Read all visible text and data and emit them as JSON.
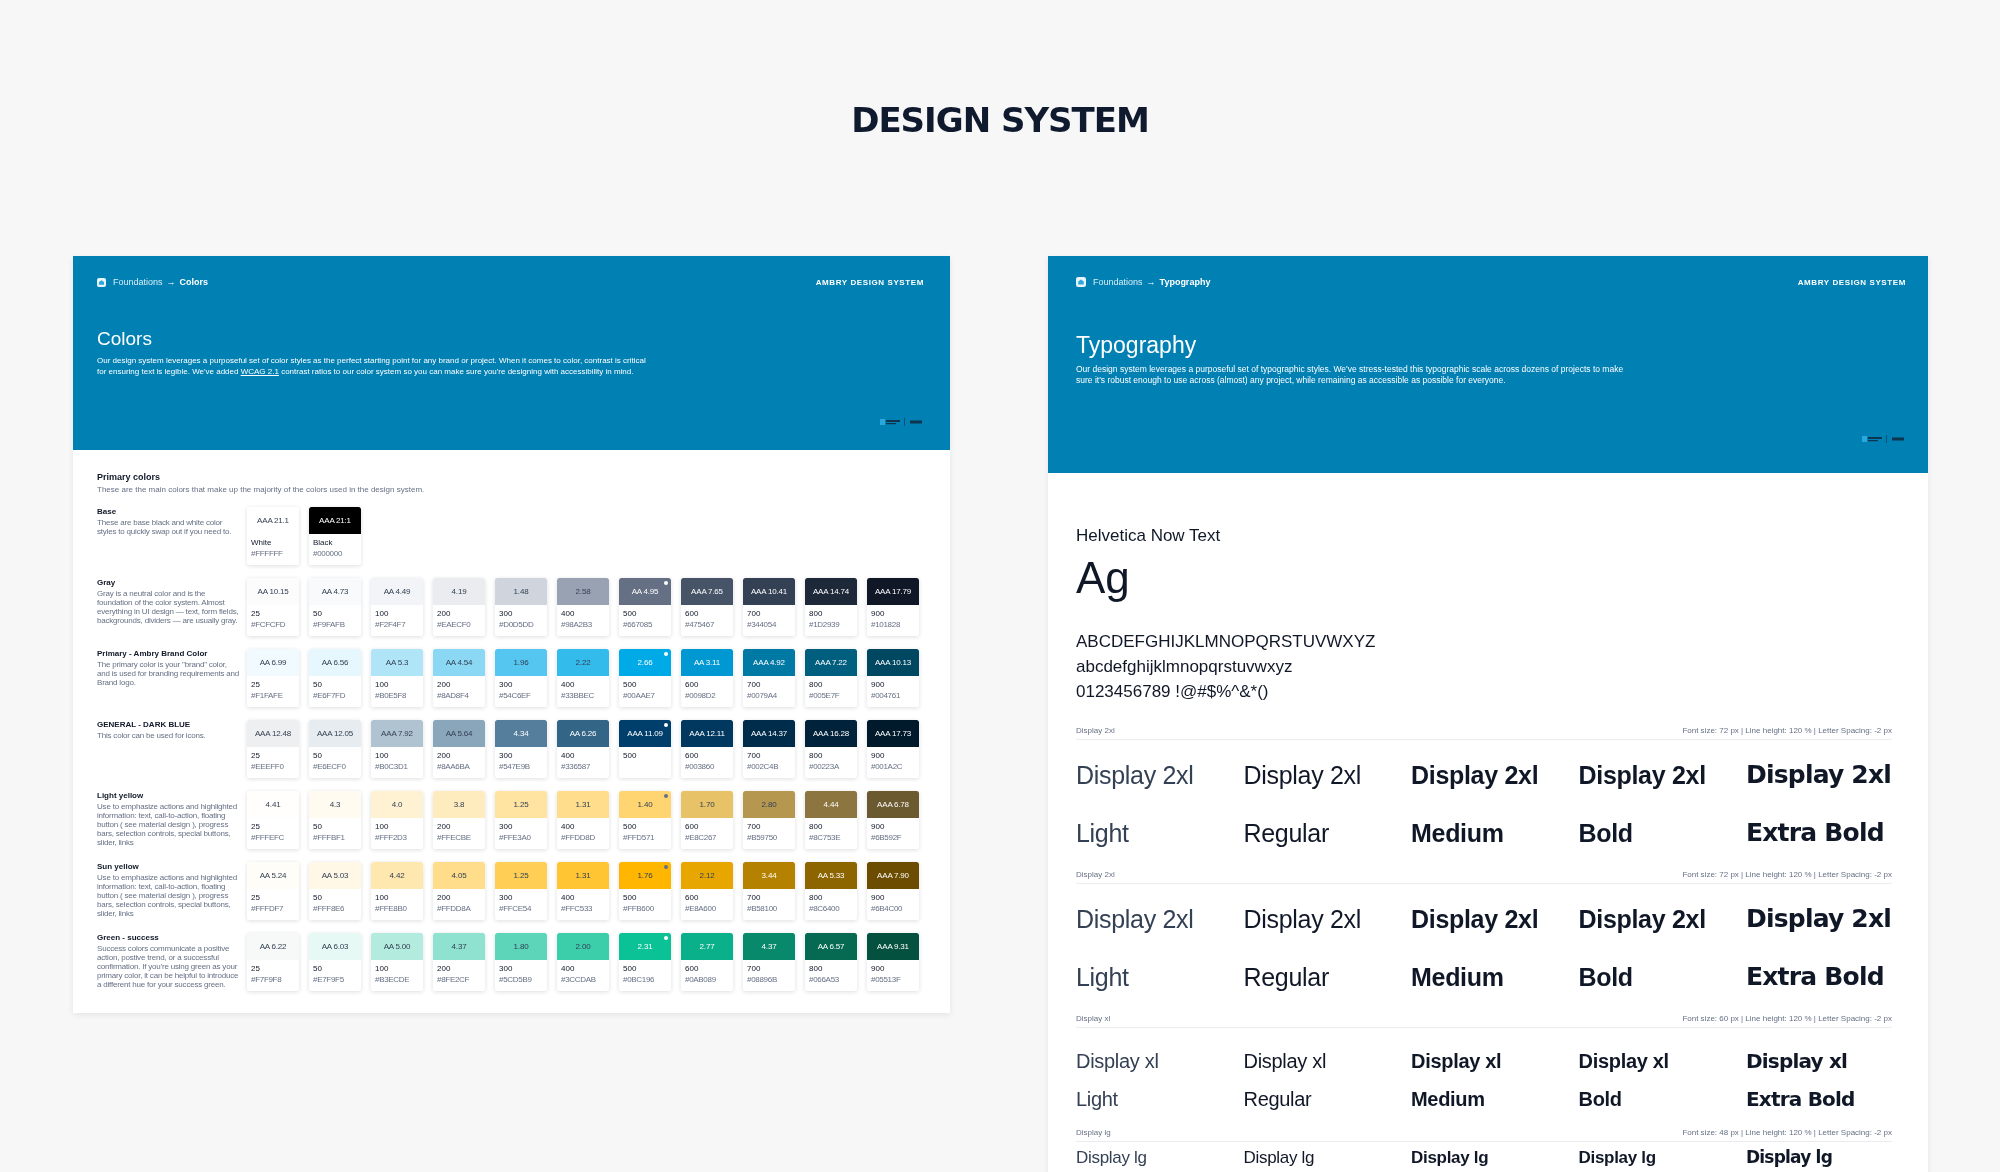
{
  "page_title": "DESIGN SYSTEM",
  "colors_page": {
    "breadcrumb": {
      "parent": "Foundations",
      "arrow": "→",
      "current": "Colors"
    },
    "brand": "AMBRY DESIGN SYSTEM",
    "title": "Colors",
    "intro": {
      "before": "Our design system leverages a purposeful set of color styles as the perfect starting point for any brand or project. When it comes to color, contrast is critical for ensuring text is legible. We've added ",
      "link": "WCAG 2.1",
      "after": " contrast ratios to our color system so you can make sure you're designing with accessibility in mind."
    },
    "section_title": "Primary colors",
    "section_subtitle": "These are the main colors that make up the majority of the colors used in the design system.",
    "groups": [
      {
        "name": "Base",
        "description": "These are base black and white color styles to quickly swap out if you need to.",
        "swatches": [
          {
            "contrast": "AAA 21.1",
            "step": "White",
            "hex": "#FFFFFF",
            "color": "#ffffff",
            "dot": false
          },
          {
            "contrast": "AAA 21:1",
            "step": "Black",
            "hex": "#000000",
            "color": "#000000",
            "dot": false
          }
        ]
      },
      {
        "name": "Gray",
        "description": "Gray is a neutral color and is the foundation of the color system. Almost everything in UI design — text, form fields, backgrounds, dividers — are usually gray.",
        "swatches": [
          {
            "contrast": "AA 10.15",
            "step": "25",
            "hex": "#FCFCFD",
            "color": "#fcfcfd",
            "dot": false
          },
          {
            "contrast": "AA 4.73",
            "step": "50",
            "hex": "#F9FAFB",
            "color": "#f9fafb",
            "dot": false
          },
          {
            "contrast": "AA 4.49",
            "step": "100",
            "hex": "#F2F4F7",
            "color": "#f2f4f7",
            "dot": false
          },
          {
            "contrast": "4.19",
            "step": "200",
            "hex": "#EAECF0",
            "color": "#eaecf0",
            "dot": false
          },
          {
            "contrast": "1.48",
            "step": "300",
            "hex": "#D0D5DD",
            "color": "#d0d5dd",
            "dot": false
          },
          {
            "contrast": "2.58",
            "step": "400",
            "hex": "#98A2B3",
            "color": "#98a2b3",
            "dot": false
          },
          {
            "contrast": "AA 4.95",
            "step": "500",
            "hex": "#667085",
            "color": "#667085",
            "dot": true
          },
          {
            "contrast": "AAA 7.65",
            "step": "600",
            "hex": "#475467",
            "color": "#475467",
            "dot": false
          },
          {
            "contrast": "AAA 10.41",
            "step": "700",
            "hex": "#344054",
            "color": "#344054",
            "dot": false
          },
          {
            "contrast": "AAA 14.74",
            "step": "800",
            "hex": "#1D2939",
            "color": "#1d2939",
            "dot": false
          },
          {
            "contrast": "AAA 17.79",
            "step": "900",
            "hex": "#101828",
            "color": "#101828",
            "dot": false
          }
        ]
      },
      {
        "name": "Primary - Ambry Brand Color",
        "description": "The primary color is your \"brand\" color, and is used for branding requirements and Brand logo.",
        "swatches": [
          {
            "contrast": "AA 6.99",
            "step": "25",
            "hex": "#F1FAFE",
            "color": "#f1fafe",
            "dot": false
          },
          {
            "contrast": "AA 6.56",
            "step": "50",
            "hex": "#E6F7FD",
            "color": "#e6f7fd",
            "dot": false
          },
          {
            "contrast": "AA 5.3",
            "step": "100",
            "hex": "#B0E5F8",
            "color": "#b0e5f8",
            "dot": false
          },
          {
            "contrast": "AA 4.54",
            "step": "200",
            "hex": "#8AD8F4",
            "color": "#8ad8f4",
            "dot": false
          },
          {
            "contrast": "1.96",
            "step": "300",
            "hex": "#54C6EF",
            "color": "#54c6ef",
            "dot": false
          },
          {
            "contrast": "2.22",
            "step": "400",
            "hex": "#33BBEC",
            "color": "#33bbec",
            "dot": false
          },
          {
            "contrast": "2.66",
            "step": "500",
            "hex": "#00AAE7",
            "color": "#00aae7",
            "dot": true
          },
          {
            "contrast": "AA 3.11",
            "step": "600",
            "hex": "#0098D2",
            "color": "#0098d2",
            "dot": false
          },
          {
            "contrast": "AAA 4.92",
            "step": "700",
            "hex": "#0079A4",
            "color": "#0079a4",
            "dot": false
          },
          {
            "contrast": "AAA 7.22",
            "step": "800",
            "hex": "#005E7F",
            "color": "#005e7f",
            "dot": false
          },
          {
            "contrast": "AAA 10.13",
            "step": "900",
            "hex": "#004761",
            "color": "#004761",
            "dot": false
          }
        ]
      },
      {
        "name": "GENERAL - DARK BLUE",
        "description": "This color can be used for icons.",
        "swatches": [
          {
            "contrast": "AAA 12.48",
            "step": "25",
            "hex": "#EEEFF0",
            "color": "#eeeff0",
            "dot": false
          },
          {
            "contrast": "AAA 12.05",
            "step": "50",
            "hex": "#E6ECF0",
            "color": "#e6ecf0",
            "dot": false
          },
          {
            "contrast": "AAA 7.92",
            "step": "100",
            "hex": "#B0C3D1",
            "color": "#b0c3d1",
            "dot": false
          },
          {
            "contrast": "AA 5.64",
            "step": "200",
            "hex": "#8AA6BA",
            "color": "#8aa6ba",
            "dot": false
          },
          {
            "contrast": "4.34",
            "step": "300",
            "hex": "#547E9B",
            "color": "#547e9b",
            "dot": false
          },
          {
            "contrast": "AA 6.26",
            "step": "400",
            "hex": "#336587",
            "color": "#336587",
            "dot": false
          },
          {
            "contrast": "AAA 11.09",
            "step": "500",
            "color": "#003f6b",
            "dot": true
          },
          {
            "contrast": "AAA 12.11",
            "step": "600",
            "hex": "#003860",
            "color": "#003860",
            "dot": false
          },
          {
            "contrast": "AAA 14.37",
            "step": "700",
            "hex": "#002C4B",
            "color": "#002c4b",
            "dot": false
          },
          {
            "contrast": "AAA 16.28",
            "step": "800",
            "hex": "#00223A",
            "color": "#00223a",
            "dot": false
          },
          {
            "contrast": "AAA 17.73",
            "step": "900",
            "hex": "#001A2C",
            "color": "#001a2c",
            "dot": false
          }
        ]
      },
      {
        "name": "Light yellow",
        "description": "Use to emphasize actions and highlighted information: text, call-to-action, floating button ( see material design ), progress bars, selection controls, special buttons, slider, links",
        "swatches": [
          {
            "contrast": "4.41",
            "step": "25",
            "hex": "#FFFEFC",
            "color": "#fffefc",
            "dot": false
          },
          {
            "contrast": "4.3",
            "step": "50",
            "hex": "#FFFBF1",
            "color": "#fffbf1",
            "dot": false
          },
          {
            "contrast": "4.0",
            "step": "100",
            "hex": "#FFF2D3",
            "color": "#fff2d3",
            "dot": false
          },
          {
            "contrast": "3.8",
            "step": "200",
            "hex": "#FFECBE",
            "color": "#ffecbe",
            "dot": false
          },
          {
            "contrast": "1.25",
            "step": "300",
            "hex": "#FFE3A0",
            "color": "#ffe3a0",
            "dot": false
          },
          {
            "contrast": "1.31",
            "step": "400",
            "hex": "#FFDD8D",
            "color": "#ffdd8d",
            "dot": false
          },
          {
            "contrast": "1.40",
            "step": "500",
            "hex": "#FFD571",
            "color": "#ffd571",
            "dot": true
          },
          {
            "contrast": "1.70",
            "step": "600",
            "hex": "#E8C267",
            "color": "#e8c267",
            "dot": false
          },
          {
            "contrast": "2.80",
            "step": "700",
            "hex": "#B59750",
            "color": "#b59750",
            "dot": false
          },
          {
            "contrast": "4.44",
            "step": "800",
            "hex": "#8C753E",
            "color": "#8c753e",
            "dot": false
          },
          {
            "contrast": "AAA 6.78",
            "step": "900",
            "hex": "#6B592F",
            "color": "#6b592f",
            "dot": false
          }
        ]
      },
      {
        "name": "Sun yellow",
        "description": "Use to emphasize actions and highlighted information: text, call-to-action, floating button ( see material design ), progress bars, selection controls, special buttons, slider, links",
        "swatches": [
          {
            "contrast": "AA 5.24",
            "step": "25",
            "hex": "#FFFDF7",
            "color": "#fffdf7",
            "dot": false
          },
          {
            "contrast": "AA 5.03",
            "step": "50",
            "hex": "#FFF8E6",
            "color": "#fff8e6",
            "dot": false
          },
          {
            "contrast": "4.42",
            "step": "100",
            "hex": "#FFE8B0",
            "color": "#ffe8b0",
            "dot": false
          },
          {
            "contrast": "4.05",
            "step": "200",
            "hex": "#FFDD8A",
            "color": "#ffdd8a",
            "dot": false
          },
          {
            "contrast": "1.25",
            "step": "300",
            "hex": "#FFCE54",
            "color": "#ffce54",
            "dot": false
          },
          {
            "contrast": "1.31",
            "step": "400",
            "hex": "#FFC533",
            "color": "#ffc533",
            "dot": false
          },
          {
            "contrast": "1.76",
            "step": "500",
            "hex": "#FFB600",
            "color": "#ffb600",
            "dot": true
          },
          {
            "contrast": "2.12",
            "step": "600",
            "hex": "#E8A600",
            "color": "#e8a600",
            "dot": false
          },
          {
            "contrast": "3.44",
            "step": "700",
            "hex": "#B58100",
            "color": "#b58100",
            "dot": false
          },
          {
            "contrast": "AA 5.33",
            "step": "800",
            "hex": "#8C6400",
            "color": "#8c6400",
            "dot": false
          },
          {
            "contrast": "AAA 7.90",
            "step": "900",
            "hex": "#6B4C00",
            "color": "#6b4c00",
            "dot": false
          }
        ]
      },
      {
        "name": "Green - success",
        "description": "Success colors communicate a positive action, postive trend, or a successful confirmation. If you're using green as your primary color, it can be helpful to introduce a different hue for your success green.",
        "swatches": [
          {
            "contrast": "AA 6.22",
            "step": "25",
            "hex": "#F7F9F8",
            "color": "#f7f9f8",
            "dot": false
          },
          {
            "contrast": "AA 6.03",
            "step": "50",
            "hex": "#E7F9F5",
            "color": "#e7f9f5",
            "dot": false
          },
          {
            "contrast": "AA 5.00",
            "step": "100",
            "hex": "#B3ECDE",
            "color": "#b3ecde",
            "dot": false
          },
          {
            "contrast": "4.37",
            "step": "200",
            "hex": "#8FE2CF",
            "color": "#8fe2cf",
            "dot": false
          },
          {
            "contrast": "1.80",
            "step": "300",
            "hex": "#5CD5B9",
            "color": "#5cd5b9",
            "dot": false
          },
          {
            "contrast": "2.00",
            "step": "400",
            "hex": "#3CCDAB",
            "color": "#3ccdab",
            "dot": false
          },
          {
            "contrast": "2.31",
            "step": "500",
            "hex": "#0BC196",
            "color": "#0bc196",
            "dot": true
          },
          {
            "contrast": "2.77",
            "step": "600",
            "hex": "#0AB089",
            "color": "#0ab089",
            "dot": false
          },
          {
            "contrast": "4.37",
            "step": "700",
            "hex": "#08896B",
            "color": "#08896b",
            "dot": false
          },
          {
            "contrast": "AA 6.57",
            "step": "800",
            "hex": "#066A53",
            "color": "#066a53",
            "dot": false
          },
          {
            "contrast": "AAA 9.31",
            "step": "900",
            "hex": "#05513F",
            "color": "#05513f",
            "dot": false
          }
        ]
      }
    ]
  },
  "typography_page": {
    "breadcrumb": {
      "parent": "Foundations",
      "arrow": "→",
      "current": "Typography"
    },
    "brand": "AMBRY DESIGN SYSTEM",
    "title": "Typography",
    "intro": "Our design system leverages a purposeful set of typographic styles. We've stress-tested this typographic scale across dozens of projects to make sure it's robust enough to use across (almost) any project, while remaining as accessible as possible for everyone.",
    "font_name": "Helvetica Now Text",
    "glyph_sample": "Ag",
    "charset": [
      "ABCDEFGHIJKLMNOPQRSTUVWXYZ",
      "abcdefghijklmnopqrstuvwxyz",
      "0123456789 !@#$%^&*()"
    ],
    "sections": [
      {
        "kind": "display-2xl",
        "label": "Display 2xl",
        "spec": "Font size: 72 px | Line height: 120 % | Letter Spacing: -2 px",
        "samples": [
          "Display 2xl",
          "Display 2xl",
          "Display 2xl",
          "Display 2xl",
          "Display 2xl"
        ],
        "weights": [
          "Light",
          "Regular",
          "Medium",
          "Bold",
          "Extra Bold"
        ]
      },
      {
        "kind": "display-2xl",
        "label": "Display 2xl",
        "spec": "Font size: 72 px | Line height: 120 % | Letter Spacing: -2 px",
        "samples": [
          "Display 2xl",
          "Display 2xl",
          "Display 2xl",
          "Display 2xl",
          "Display 2xl"
        ],
        "weights": [
          "Light",
          "Regular",
          "Medium",
          "Bold",
          "Extra Bold"
        ]
      },
      {
        "kind": "display-xl",
        "label": "Display xl",
        "spec": "Font size: 60 px | Line height: 120 % | Letter Spacing: -2 px",
        "samples": [
          "Display xl",
          "Display xl",
          "Display xl",
          "Display xl",
          "Display xl"
        ],
        "weights": [
          "Light",
          "Regular",
          "Medium",
          "Bold",
          "Extra Bold"
        ]
      },
      {
        "kind": "display-lg",
        "label": "Display lg",
        "spec": "Font size: 48 px | Line height: 120 % | Letter Spacing: -2 px",
        "samples": [
          "Display lg",
          "Display lg",
          "Display lg",
          "Display lg",
          "Display lg"
        ]
      }
    ]
  }
}
